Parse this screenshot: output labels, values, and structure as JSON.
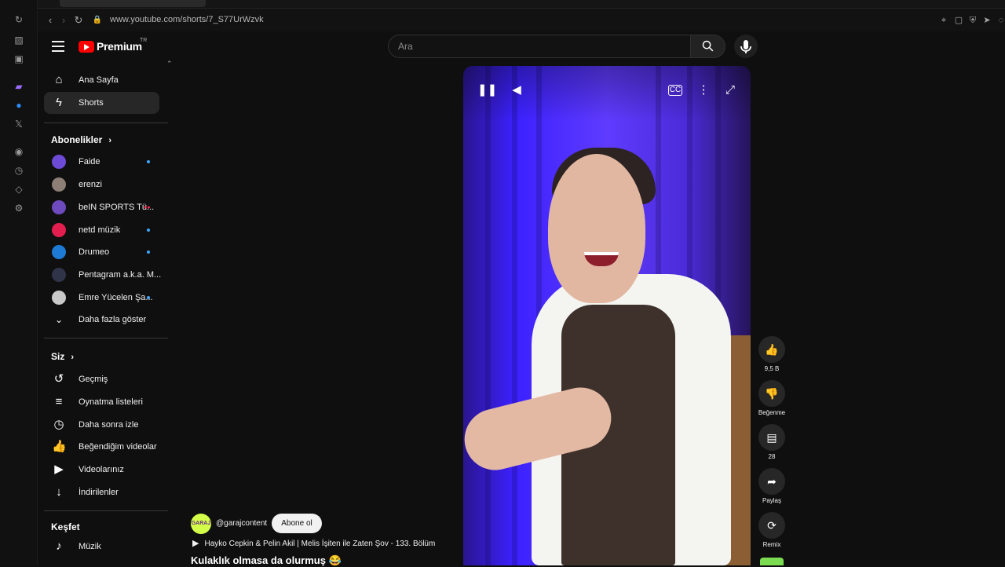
{
  "browser": {
    "url": "www.youtube.com/shorts/7_S77UrWzvk",
    "rail_icons": [
      "refresh-icon",
      "extension-icon",
      "tab-icon",
      "twitch-icon",
      "messenger-icon",
      "x-icon",
      "play-circle-icon",
      "clock-icon",
      "puzzle-icon",
      "settings-icon"
    ],
    "toolbar_icons": [
      "back-icon",
      "forward-icon",
      "reload-icon",
      "lock-icon"
    ],
    "right_icons": [
      "pin-icon",
      "tab-manager-icon",
      "shield-icon",
      "share-icon",
      "user-icon"
    ]
  },
  "youtube": {
    "brand": "Premium",
    "region": "TR",
    "search": {
      "placeholder": "Ara",
      "value": ""
    },
    "nav": [
      {
        "label": "Ana Sayfa",
        "icon": "home-icon"
      },
      {
        "label": "Shorts",
        "icon": "shorts-icon",
        "active": true
      }
    ],
    "subscriptions": {
      "title": "Abonelikler",
      "items": [
        {
          "name": "Faide",
          "avatar_color": "#6d4bd6",
          "badge": "dot"
        },
        {
          "name": "erenzi",
          "avatar_color": "#8d7f76",
          "badge": ""
        },
        {
          "name": "beIN SPORTS Tü...",
          "avatar_color": "#6e4abf",
          "badge": "live"
        },
        {
          "name": "netd müzik",
          "avatar_color": "#e21e4e",
          "badge": "dot"
        },
        {
          "name": "Drumeo",
          "avatar_color": "#1d7bd6",
          "badge": "dot"
        },
        {
          "name": "Pentagram a.k.a. M...",
          "avatar_color": "#2f3448",
          "badge": ""
        },
        {
          "name": "Emre Yücelen Şa...",
          "avatar_color": "#c9c9c9",
          "badge": "dot"
        }
      ],
      "show_more": "Daha fazla göster"
    },
    "you": {
      "title": "Siz",
      "items": [
        {
          "label": "Geçmiş",
          "icon": "history-icon"
        },
        {
          "label": "Oynatma listeleri",
          "icon": "playlist-icon"
        },
        {
          "label": "Daha sonra izle",
          "icon": "watch-later-icon"
        },
        {
          "label": "Beğendiğim videolar",
          "icon": "liked-videos-icon"
        },
        {
          "label": "Videolarınız",
          "icon": "your-videos-icon"
        },
        {
          "label": "İndirilenler",
          "icon": "download-icon"
        }
      ]
    },
    "explore": {
      "title": "Keşfet",
      "items": [
        {
          "label": "Müzik",
          "icon": "music-icon"
        }
      ]
    },
    "player": {
      "controls": [
        "pause-icon",
        "volume-icon",
        "captions-icon",
        "more-icon",
        "fullscreen-icon"
      ]
    },
    "actions": [
      {
        "label": "9,5 B",
        "icon": "like-icon"
      },
      {
        "label": "Beğenme",
        "icon": "dislike-icon"
      },
      {
        "label": "28",
        "icon": "comment-icon"
      },
      {
        "label": "Paylaş",
        "icon": "share-icon"
      },
      {
        "label": "Remix",
        "icon": "remix-icon"
      }
    ],
    "short": {
      "avatar_text": "GARAJ",
      "channel_handle": "@garajcontent",
      "subscribe_label": "Abone ol",
      "episode": "Hayko Cepkin & Pelin Akil | Melis İşiten ile Zaten Şov - 133. Bölüm",
      "title": "Kulaklık olmasa da olurmuş 😂"
    },
    "accent": "#ff0000"
  }
}
